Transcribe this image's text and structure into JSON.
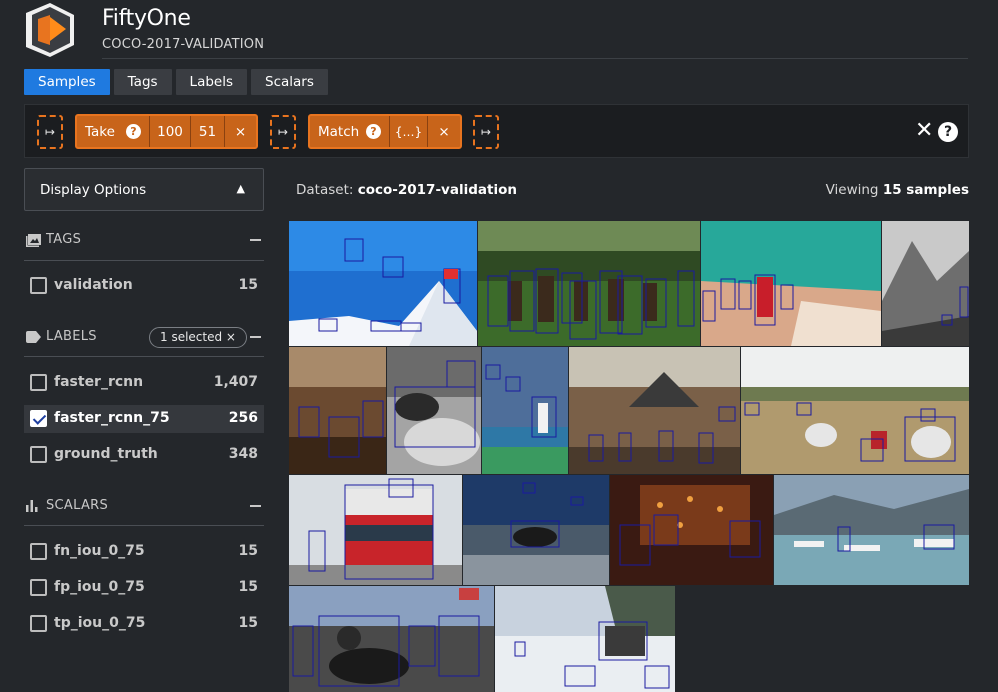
{
  "header": {
    "title": "FiftyOne",
    "subtitle": "COCO-2017-VALIDATION"
  },
  "tabs": [
    {
      "label": "Samples",
      "active": true
    },
    {
      "label": "Tags",
      "active": false
    },
    {
      "label": "Labels",
      "active": false
    },
    {
      "label": "Scalars",
      "active": false
    }
  ],
  "view_bar": {
    "add_stage_glyph": "↦",
    "close_glyph": "✕",
    "help_glyph": "?",
    "stages": [
      {
        "name": "Take",
        "help": "?",
        "params": [
          "100",
          "51"
        ],
        "remove": "×"
      },
      {
        "name": "Match",
        "help": "?",
        "params": [
          "{…}"
        ],
        "remove": "×"
      }
    ]
  },
  "sidebar": {
    "display_options": {
      "label": "Display Options"
    },
    "tags": {
      "title": "TAGS",
      "icon": "image-icon",
      "items": [
        {
          "name": "validation",
          "count": "15",
          "checked": false
        }
      ]
    },
    "labels": {
      "title": "LABELS",
      "icon": "tag-icon",
      "selected_pill": "1 selected ×",
      "items": [
        {
          "name": "faster_rcnn",
          "count": "1,407",
          "checked": false
        },
        {
          "name": "faster_rcnn_75",
          "count": "256",
          "checked": true
        },
        {
          "name": "ground_truth",
          "count": "348",
          "checked": false
        }
      ]
    },
    "scalars": {
      "title": "SCALARS",
      "icon": "bar-chart-icon",
      "items": [
        {
          "name": "fn_iou_0_75",
          "count": "15",
          "checked": false
        },
        {
          "name": "fp_iou_0_75",
          "count": "15",
          "checked": false
        },
        {
          "name": "tp_iou_0_75",
          "count": "15",
          "checked": false
        }
      ]
    }
  },
  "main": {
    "dataset_prefix": "Dataset:",
    "dataset_name": "coco-2017-validation",
    "viewing_prefix": "Viewing",
    "viewing_count": "15 samples"
  },
  "colors": {
    "accent": "#1f7ae0",
    "stage_orange": "#e8741f",
    "background": "#24272b",
    "box": "#1a1aa0"
  }
}
